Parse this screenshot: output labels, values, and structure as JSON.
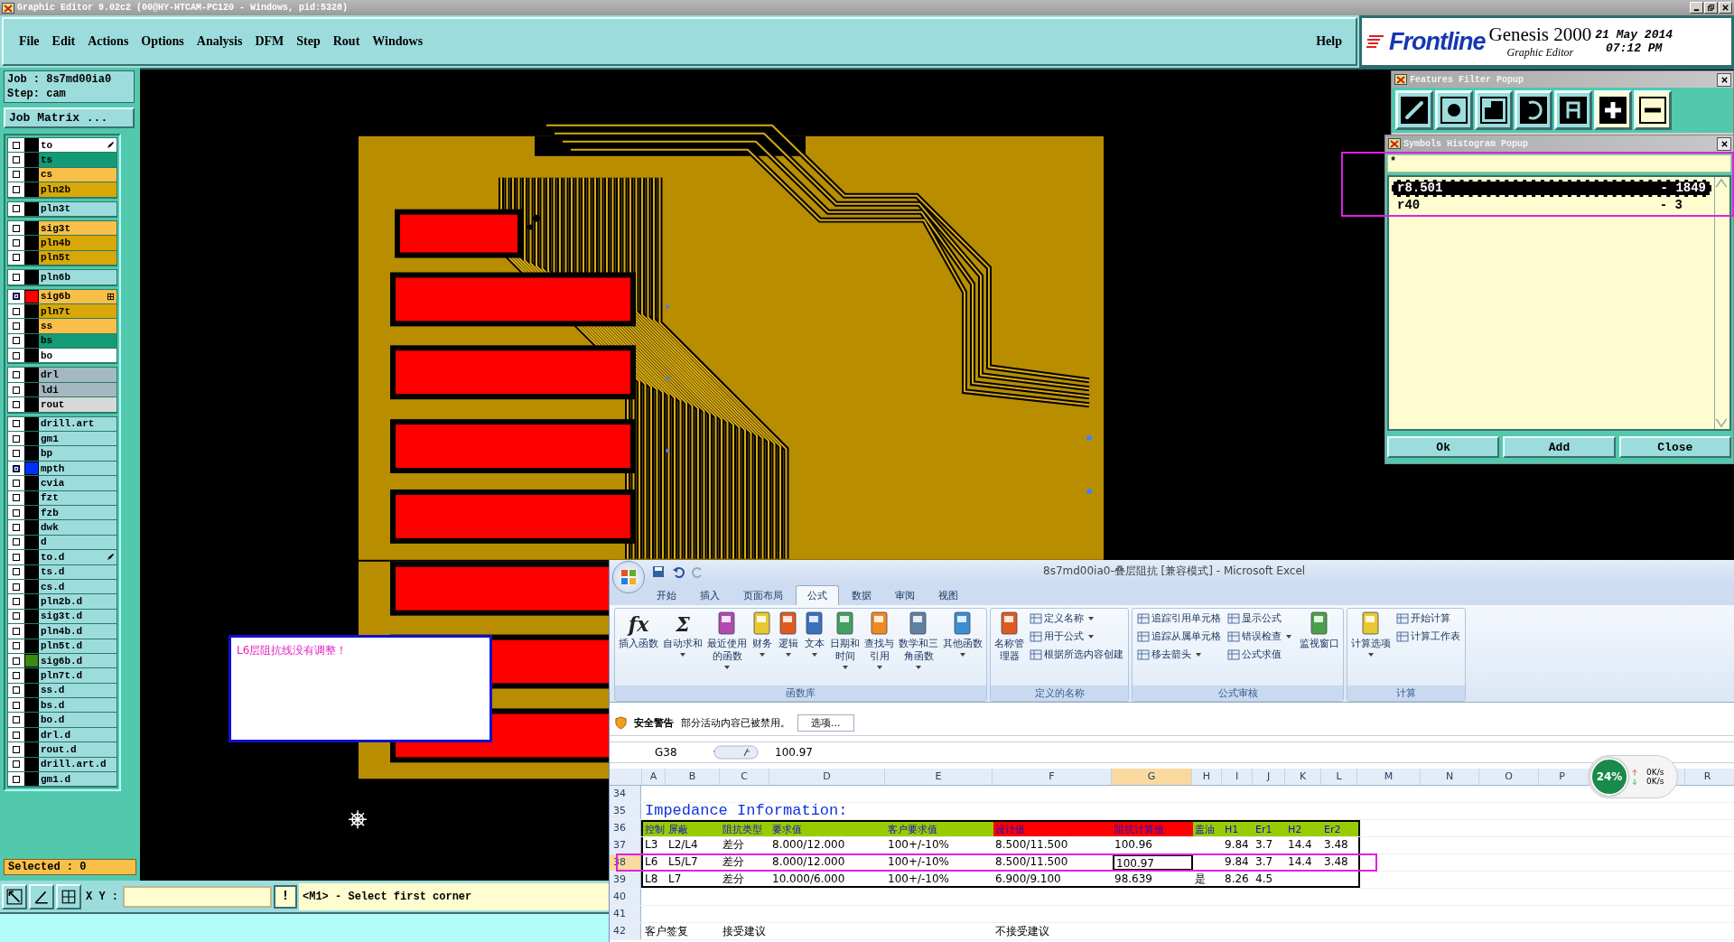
{
  "window": {
    "title": "Graphic Editor 9.02c2 (00@HY-HTCAM-PC120 - Windows, pid:5328)"
  },
  "menu": [
    "File",
    "Edit",
    "Actions",
    "Options",
    "Analysis",
    "DFM",
    "Step",
    "Rout",
    "Windows"
  ],
  "help": "Help",
  "brand": {
    "logo": "Frontline",
    "product": "Genesis 2000",
    "subtitle": "Graphic Editor",
    "date": "21 May 2014",
    "time": "07:12 PM"
  },
  "job": {
    "job": "Job : 8s7md00ia0",
    "step": "Step: cam",
    "matrix_button": "Job Matrix ..."
  },
  "layer_groups": [
    [
      {
        "name": "to",
        "color": "#ffffff",
        "affected": false,
        "kind": "pen"
      },
      {
        "name": "ts",
        "color": "#129b74",
        "affected": false,
        "kind": "plain"
      },
      {
        "name": "cs",
        "color": "#f8c048",
        "affected": false,
        "kind": "plain"
      },
      {
        "name": "pln2b",
        "color": "#d8a808",
        "affected": false,
        "kind": "plain"
      }
    ],
    [
      {
        "name": "pln3t",
        "color": "#9ddcdc",
        "affected": false,
        "kind": "plain"
      }
    ],
    [
      {
        "name": "sig3t",
        "color": "#f8c048",
        "affected": false,
        "kind": "plain"
      },
      {
        "name": "pln4b",
        "color": "#d8a808",
        "affected": false,
        "kind": "plain"
      },
      {
        "name": "pln5t",
        "color": "#d8a808",
        "affected": false,
        "kind": "plain"
      }
    ],
    [
      {
        "name": "pln6b",
        "color": "#9ddcdc",
        "affected": false,
        "kind": "plain"
      }
    ],
    [
      {
        "name": "sig6b",
        "color": "#f8c048",
        "affected": true,
        "swatch": {
          "color": "#ff0000"
        },
        "kind": "grid"
      },
      {
        "name": "pln7t",
        "color": "#d8a808",
        "affected": false,
        "kind": "plain"
      },
      {
        "name": "ss",
        "color": "#f8c048",
        "affected": false,
        "kind": "plain"
      },
      {
        "name": "bs",
        "color": "#129b74",
        "affected": false,
        "kind": "plain"
      },
      {
        "name": "bo",
        "color": "#ffffff",
        "affected": false,
        "kind": "plain"
      }
    ],
    [
      {
        "name": "drl",
        "color": "#a4b8c0",
        "affected": false,
        "kind": "plain"
      },
      {
        "name": "ldi",
        "color": "#a4b8c0",
        "affected": false,
        "kind": "plain"
      },
      {
        "name": "rout",
        "color": "#d8d8d8",
        "affected": false,
        "kind": "plain"
      }
    ],
    [
      {
        "name": "drill.art",
        "color": "#9ddcdc",
        "affected": false,
        "kind": "plain"
      },
      {
        "name": "gm1",
        "color": "#9ddcdc",
        "affected": false,
        "kind": "plain"
      },
      {
        "name": "bp",
        "color": "#9ddcdc",
        "affected": false,
        "kind": "plain"
      },
      {
        "name": "mpth",
        "color": "#9ddcdc",
        "affected": true,
        "swatch": {
          "color": "#0030ff"
        },
        "kind": "plain"
      },
      {
        "name": "cvia",
        "color": "#9ddcdc",
        "affected": false,
        "kind": "plain"
      },
      {
        "name": "fzt",
        "color": "#9ddcdc",
        "affected": false,
        "kind": "plain"
      },
      {
        "name": "fzb",
        "color": "#9ddcdc",
        "affected": false,
        "kind": "plain"
      },
      {
        "name": "dwk",
        "color": "#9ddcdc",
        "affected": false,
        "kind": "plain"
      },
      {
        "name": "d",
        "color": "#9ddcdc",
        "affected": false,
        "kind": "plain"
      },
      {
        "name": "to.d",
        "color": "#9ddcdc",
        "affected": false,
        "kind": "pen"
      },
      {
        "name": "ts.d",
        "color": "#9ddcdc",
        "affected": false,
        "kind": "plain"
      },
      {
        "name": "cs.d",
        "color": "#9ddcdc",
        "affected": false,
        "kind": "plain"
      },
      {
        "name": "pln2b.d",
        "color": "#9ddcdc",
        "affected": false,
        "kind": "plain"
      },
      {
        "name": "sig3t.d",
        "color": "#9ddcdc",
        "affected": false,
        "kind": "plain"
      },
      {
        "name": "pln4b.d",
        "color": "#9ddcdc",
        "affected": false,
        "kind": "plain"
      },
      {
        "name": "pln5t.d",
        "color": "#9ddcdc",
        "affected": false,
        "kind": "plain"
      },
      {
        "name": "sig6b.d",
        "color": "#9ddcdc",
        "affected": false,
        "swatch": {
          "color": "#3a8a10"
        },
        "kind": "plain"
      },
      {
        "name": "pln7t.d",
        "color": "#9ddcdc",
        "affected": false,
        "kind": "plain"
      },
      {
        "name": "ss.d",
        "color": "#9ddcdc",
        "affected": false,
        "kind": "plain"
      },
      {
        "name": "bs.d",
        "color": "#9ddcdc",
        "affected": false,
        "kind": "plain"
      },
      {
        "name": "bo.d",
        "color": "#9ddcdc",
        "affected": false,
        "kind": "plain"
      },
      {
        "name": "drl.d",
        "color": "#9ddcdc",
        "affected": false,
        "kind": "plain"
      },
      {
        "name": "rout.d",
        "color": "#9ddcdc",
        "affected": false,
        "kind": "plain"
      },
      {
        "name": "drill.art.d",
        "color": "#9ddcdc",
        "affected": false,
        "kind": "plain"
      },
      {
        "name": "gm1.d",
        "color": "#9ddcdc",
        "affected": false,
        "kind": "plain"
      }
    ]
  ],
  "selected_count": "Selected : 0",
  "message_box": {
    "text": "L6层阻抗线没有调整！"
  },
  "bottom_bar": {
    "xy_label": "X Y :",
    "prompt": "<M1> - Select first corner",
    "alert": "!"
  },
  "features_filter": {
    "title": "Features Filter Popup",
    "tools": [
      {
        "kind": "line"
      },
      {
        "kind": "pad"
      },
      {
        "kind": "surface"
      },
      {
        "kind": "arc"
      },
      {
        "kind": "text"
      },
      {
        "kind": "plus"
      },
      {
        "kind": "minus"
      }
    ]
  },
  "histogram": {
    "title": "Symbols Histogram Popup",
    "filter": "*",
    "symbols": [
      {
        "symbol": "r8.501",
        "count": "- 1849",
        "selected": true
      },
      {
        "symbol": "r40",
        "count": "- 3",
        "selected": false
      }
    ],
    "buttons": [
      "Ok",
      "Add",
      "Close"
    ]
  },
  "excel": {
    "title": "8s7md00ia0-叠层阻抗  [兼容模式] - Microsoft Excel",
    "tabs": [
      {
        "label": "开始",
        "selected": false
      },
      {
        "label": "插入",
        "selected": false
      },
      {
        "label": "页面布局",
        "selected": false
      },
      {
        "label": "公式",
        "selected": true
      },
      {
        "label": "数据",
        "selected": false
      },
      {
        "label": "审阅",
        "selected": false
      },
      {
        "label": "视图",
        "selected": false
      }
    ],
    "ribbon": [
      {
        "label": "函数库",
        "items": [
          {
            "kind": "large",
            "glyph": "fx",
            "label": "插入函数",
            "dropdown": false
          },
          {
            "kind": "large",
            "glyph": "Σ",
            "label": "自动求和",
            "dropdown": true
          },
          {
            "kind": "large",
            "label": "最近使用的函数",
            "dropdown": true
          },
          {
            "kind": "large",
            "label": "财务",
            "dropdown": true
          },
          {
            "kind": "large",
            "label": "逻辑",
            "dropdown": true
          },
          {
            "kind": "large",
            "label": "文本",
            "dropdown": true
          },
          {
            "kind": "large",
            "label": "日期和时间",
            "dropdown": true
          },
          {
            "kind": "large",
            "label": "查找与引用",
            "dropdown": true
          },
          {
            "kind": "large",
            "label": "数学和三角函数",
            "dropdown": true
          },
          {
            "kind": "large",
            "label": "其他函数",
            "dropdown": true
          }
        ]
      },
      {
        "label": "定义的名称",
        "items": [
          {
            "kind": "large",
            "label": "名称管理器",
            "dropdown": false
          },
          {
            "kind": "stack",
            "items": [
              {
                "label": "定义名称",
                "dropdown": true
              },
              {
                "label": "用于公式",
                "dropdown": true
              },
              {
                "label": "根据所选内容创建",
                "dropdown": false
              }
            ]
          }
        ]
      },
      {
        "label": "公式审核",
        "items": [
          {
            "kind": "stack",
            "items": [
              {
                "label": "追踪引用单元格",
                "dropdown": false
              },
              {
                "label": "追踪从属单元格",
                "dropdown": false
              },
              {
                "label": "移去箭头",
                "dropdown": true
              }
            ]
          },
          {
            "kind": "stack",
            "items": [
              {
                "label": "显示公式",
                "dropdown": false
              },
              {
                "label": "错误检查",
                "dropdown": true
              },
              {
                "label": "公式求值",
                "dropdown": false
              }
            ]
          },
          {
            "kind": "large",
            "label": "监视窗口",
            "dropdown": false
          }
        ]
      },
      {
        "label": "计算",
        "items": [
          {
            "kind": "large",
            "label": "计算选项",
            "dropdown": true
          },
          {
            "kind": "stack",
            "items": [
              {
                "label": "开始计算",
                "dropdown": false
              },
              {
                "label": "计算工作表",
                "dropdown": false
              }
            ]
          }
        ]
      }
    ],
    "security": {
      "label": "安全警告",
      "message": "部分活动内容已被禁用。",
      "button": "选项..."
    },
    "name_box": "G38",
    "formula": "100.97",
    "columns": [
      {
        "label": "A",
        "selected": false
      },
      {
        "label": "B",
        "selected": false
      },
      {
        "label": "C",
        "selected": false
      },
      {
        "label": "D",
        "selected": false
      },
      {
        "label": "E",
        "selected": false
      },
      {
        "label": "F",
        "selected": false
      },
      {
        "label": "G",
        "selected": true
      },
      {
        "label": "H",
        "selected": false
      },
      {
        "label": "I",
        "selected": false
      },
      {
        "label": "J",
        "selected": false
      },
      {
        "label": "K",
        "selected": false
      },
      {
        "label": "L",
        "selected": false
      },
      {
        "label": "M",
        "selected": false
      },
      {
        "label": "N",
        "selected": false
      },
      {
        "label": "O",
        "selected": false
      },
      {
        "label": "P",
        "selected": false
      },
      {
        "label": "R",
        "selected": false
      }
    ],
    "rows": [
      {
        "number": "34",
        "selected": false,
        "kind": "empty",
        "cells": {}
      },
      {
        "number": "35",
        "selected": false,
        "kind": "title",
        "cells": {
          "A": {
            "text": "Impedance Information:",
            "selected": false
          }
        }
      },
      {
        "number": "36",
        "selected": false,
        "kind": "header",
        "cells": {
          "A": {
            "text": "控制",
            "fill": {
              "color": "#99cc00"
            },
            "selected": false
          },
          "B": {
            "text": "屏蔽",
            "fill": {
              "color": "#99cc00"
            },
            "selected": false
          },
          "C": {
            "text": "阻抗类型",
            "fill": {
              "color": "#99cc00"
            },
            "selected": false
          },
          "D": {
            "text": "要求值",
            "fill": {
              "color": "#99cc00"
            },
            "selected": false
          },
          "E": {
            "text": "客户要求值",
            "fill": {
              "color": "#99cc00"
            },
            "selected": false
          },
          "F": {
            "text": "设计值",
            "fill": {
              "color": "#ff0000"
            },
            "selected": false
          },
          "G": {
            "text": "阻抗计算值",
            "fill": {
              "color": "#ff0000"
            },
            "selected": false
          },
          "H": {
            "text": "盖油",
            "fill": {
              "color": "#99cc00"
            },
            "selected": false
          },
          "I": {
            "text": "H1",
            "fill": {
              "color": "#99cc00"
            },
            "selected": false
          },
          "J": {
            "text": "Er1",
            "fill": {
              "color": "#99cc00"
            },
            "selected": false
          },
          "K": {
            "text": "H2",
            "fill": {
              "color": "#99cc00"
            },
            "selected": false
          },
          "L": {
            "text": "Er2",
            "fill": {
              "color": "#99cc00"
            },
            "selected": false
          }
        }
      },
      {
        "number": "37",
        "selected": false,
        "kind": "data",
        "cells": {
          "A": {
            "text": "L3",
            "selected": false
          },
          "B": {
            "text": "L2/L4",
            "selected": false
          },
          "C": {
            "text": "差分",
            "selected": false
          },
          "D": {
            "text": "8.000/12.000",
            "selected": false
          },
          "E": {
            "text": "100+/-10%",
            "selected": false
          },
          "F": {
            "text": "8.500/11.500",
            "selected": false
          },
          "G": {
            "text": "100.96",
            "selected": false
          },
          "I": {
            "text": "9.84",
            "selected": false
          },
          "J": {
            "text": "3.7",
            "selected": false
          },
          "K": {
            "text": "14.4",
            "selected": false
          },
          "L": {
            "text": "3.48",
            "selected": false
          }
        }
      },
      {
        "number": "38",
        "selected": true,
        "kind": "data",
        "cells": {
          "A": {
            "text": "L6",
            "selected": false
          },
          "B": {
            "text": "L5/L7",
            "selected": false
          },
          "C": {
            "text": "差分",
            "selected": false
          },
          "D": {
            "text": "8.000/12.000",
            "selected": false
          },
          "E": {
            "text": "100+/-10%",
            "selected": false
          },
          "F": {
            "text": "8.500/11.500",
            "selected": false
          },
          "G": {
            "text": "100.97",
            "selected": true
          },
          "I": {
            "text": "9.84",
            "selected": false
          },
          "J": {
            "text": "3.7",
            "selected": false
          },
          "K": {
            "text": "14.4",
            "selected": false
          },
          "L": {
            "text": "3.48",
            "selected": false
          }
        }
      },
      {
        "number": "39",
        "selected": false,
        "kind": "data",
        "cells": {
          "A": {
            "text": "L8",
            "selected": false
          },
          "B": {
            "text": "L7",
            "selected": false
          },
          "C": {
            "text": "差分",
            "selected": false
          },
          "D": {
            "text": "10.000/6.000",
            "selected": false
          },
          "E": {
            "text": "100+/-10%",
            "selected": false
          },
          "F": {
            "text": "6.900/9.100",
            "selected": false
          },
          "G": {
            "text": "98.639",
            "selected": false
          },
          "H": {
            "text": "是",
            "selected": false
          },
          "I": {
            "text": "8.26",
            "selected": false
          },
          "J": {
            "text": "4.5",
            "selected": false
          }
        }
      },
      {
        "number": "40",
        "selected": false,
        "kind": "empty",
        "cells": {}
      },
      {
        "number": "41",
        "selected": false,
        "kind": "empty",
        "cells": {}
      },
      {
        "number": "42",
        "selected": false,
        "kind": "plain",
        "cells": {
          "A": {
            "text": "客户签复",
            "selected": false
          },
          "C": {
            "text": "接受建议",
            "selected": false
          },
          "F": {
            "text": "不接受建议",
            "selected": false
          }
        }
      }
    ],
    "network": {
      "percent": "24%",
      "up": "0K/s",
      "down": "0K/s"
    }
  }
}
